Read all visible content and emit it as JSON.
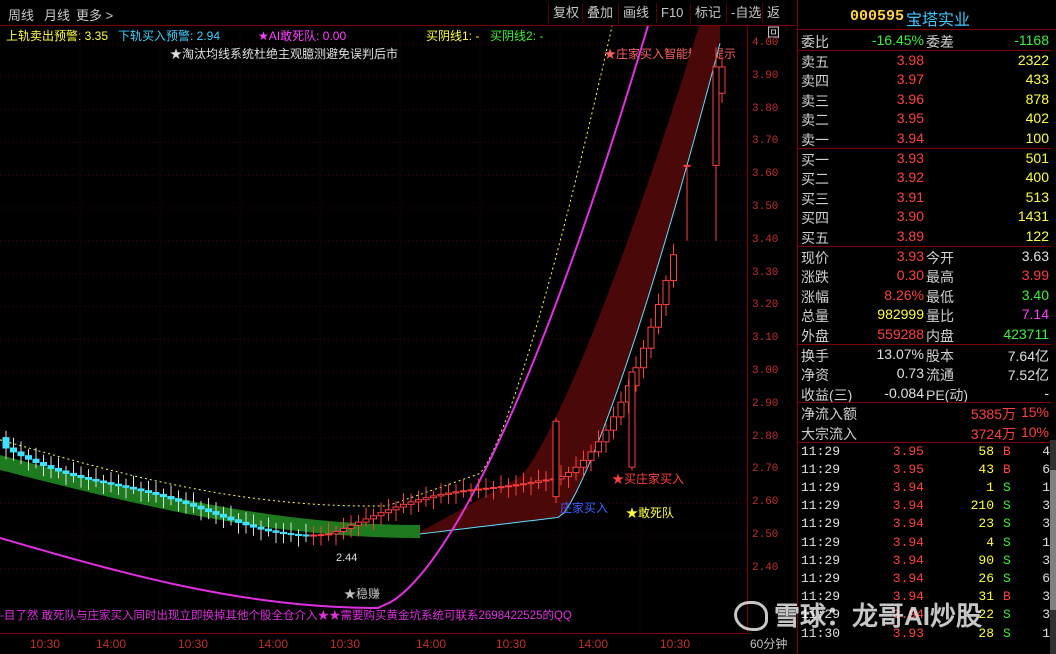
{
  "toolbar": {
    "tabs": [
      "周线",
      "月线",
      "更多 >"
    ],
    "buttons": [
      "复权",
      "叠加",
      "画线",
      "F10",
      "标记",
      "-自选",
      "返回"
    ]
  },
  "indicators": {
    "upper_warn": "上轨卖出预警: 3.35",
    "lower_warn": "下轨买入预警: 2.94",
    "ai_team": "★AI敢死队: 0.00",
    "buy_line1": "买阴线1: -",
    "buy_line2": "买阴线2: -",
    "notice": "★淘汰均线系统杜绝主观臆测避免误判后市",
    "smart_tip": "★庄家买入智能精准提示"
  },
  "chart_labels": {
    "low_price": "2.44",
    "stable": "★稳赚",
    "buy_signal1": "庄家买入",
    "buy_signal2": "★买庄家买入",
    "team_signal": "★敢死队",
    "bottom_note": "-目了然 敢死队与庄家买入同时出现立即换掉其他个股全仓介入★★需要购买黄金坑系统可联系2698422525的QQ"
  },
  "price_axis": [
    "4.00",
    "3.90",
    "3.80",
    "3.70",
    "3.60",
    "3.50",
    "3.40",
    "3.30",
    "3.20",
    "3.10",
    "3.00",
    "2.90",
    "2.80",
    "2.70",
    "2.60",
    "2.50",
    "2.40"
  ],
  "time_axis": [
    "10:30",
    "14:00",
    "10:30",
    "14:00",
    "10:30",
    "14:00",
    "10:30",
    "14:00",
    "10:30",
    "14:00",
    "10:30",
    "14:00"
  ],
  "period": "60分钟",
  "stock": {
    "code": "000595",
    "name": "宝塔实业"
  },
  "order_ratio": {
    "label": "委比",
    "value": "-16.45%",
    "diff_label": "委差",
    "diff": "-1168"
  },
  "asks": [
    {
      "label": "卖五",
      "price": "3.98",
      "vol": "2322"
    },
    {
      "label": "卖四",
      "price": "3.97",
      "vol": "433"
    },
    {
      "label": "卖三",
      "price": "3.96",
      "vol": "878"
    },
    {
      "label": "卖二",
      "price": "3.95",
      "vol": "402"
    },
    {
      "label": "卖一",
      "price": "3.94",
      "vol": "100"
    }
  ],
  "bids": [
    {
      "label": "买一",
      "price": "3.93",
      "vol": "501"
    },
    {
      "label": "买二",
      "price": "3.92",
      "vol": "400"
    },
    {
      "label": "买三",
      "price": "3.91",
      "vol": "513"
    },
    {
      "label": "买四",
      "price": "3.90",
      "vol": "1431"
    },
    {
      "label": "买五",
      "price": "3.89",
      "vol": "122"
    }
  ],
  "quote": [
    {
      "l1": "现价",
      "v1": "3.93",
      "l2": "今开",
      "v2": "3.63"
    },
    {
      "l1": "涨跌",
      "v1": "0.30",
      "l2": "最高",
      "v2": "3.99"
    },
    {
      "l1": "涨幅",
      "v1": "8.26%",
      "l2": "最低",
      "v2": "3.40"
    },
    {
      "l1": "总量",
      "v1": "982999",
      "l2": "量比",
      "v2": "7.14"
    },
    {
      "l1": "外盘",
      "v1": "559288",
      "l2": "内盘",
      "v2": "423711"
    }
  ],
  "fund": [
    {
      "l1": "换手",
      "v1": "13.07%",
      "l2": "股本",
      "v2": "7.64亿"
    },
    {
      "l1": "净资",
      "v1": "0.73",
      "l2": "流通",
      "v2": "7.52亿"
    },
    {
      "l1": "收益(三)",
      "v1": "-0.084",
      "l2": "PE(动)",
      "v2": "-"
    }
  ],
  "flow": [
    {
      "label": "净流入额",
      "value": "5385万",
      "pct": "15%"
    },
    {
      "label": "大宗流入",
      "value": "3724万",
      "pct": "10%"
    }
  ],
  "trades": [
    {
      "time": "11:29",
      "price": "3.95",
      "vol": "58",
      "side": "B",
      "n": "4"
    },
    {
      "time": "11:29",
      "price": "3.95",
      "vol": "43",
      "side": "B",
      "n": "6"
    },
    {
      "time": "11:29",
      "price": "3.94",
      "vol": "1",
      "side": "S",
      "n": "1"
    },
    {
      "time": "11:29",
      "price": "3.94",
      "vol": "210",
      "side": "S",
      "n": "3"
    },
    {
      "time": "11:29",
      "price": "3.94",
      "vol": "23",
      "side": "S",
      "n": "3"
    },
    {
      "time": "11:29",
      "price": "3.94",
      "vol": "4",
      "side": "S",
      "n": "1"
    },
    {
      "time": "11:29",
      "price": "3.94",
      "vol": "90",
      "side": "S",
      "n": "3"
    },
    {
      "time": "11:29",
      "price": "3.94",
      "vol": "26",
      "side": "S",
      "n": "6"
    },
    {
      "time": "11:29",
      "price": "3.94",
      "vol": "31",
      "side": "B",
      "n": "3"
    },
    {
      "time": "11:29",
      "price": "3.94",
      "vol": "22",
      "side": "S",
      "n": "3"
    },
    {
      "time": "11:30",
      "price": "3.93",
      "vol": "28",
      "side": "S",
      "n": "1"
    }
  ],
  "watermark": "雪球：龙哥AI炒股",
  "colors": {
    "up": "#ff4040",
    "down": "#3cf03c",
    "border": "#800000",
    "band": "#1e7a1e",
    "band_dark": "#5a0e0e"
  }
}
